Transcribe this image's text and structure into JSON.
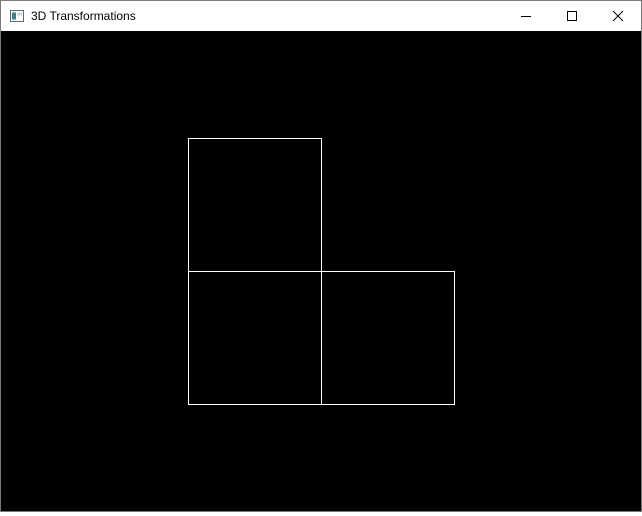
{
  "window": {
    "title": "3D Transformations"
  },
  "icons": {
    "app": "app-window-icon",
    "minimize": "minimize-icon",
    "maximize": "maximize-icon",
    "close": "close-icon"
  },
  "colors": {
    "canvas_background": "#000000",
    "line": "#ffffff",
    "titlebar_background": "#ffffff",
    "title_text": "#000000"
  },
  "scene": {
    "description_shape": "three wireframe squares forming an L shape"
  }
}
